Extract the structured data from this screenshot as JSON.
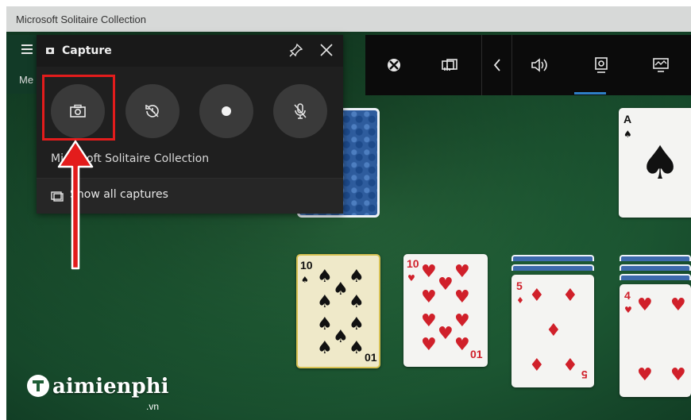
{
  "window": {
    "title": "Microsoft Solitaire Collection"
  },
  "game": {
    "menu_label": "Me"
  },
  "capture_widget": {
    "title": "Capture",
    "app_name": "Microsoft Solitaire Collection",
    "show_all_label": "Show all captures",
    "buttons": [
      "screenshot",
      "record-last",
      "start-recording",
      "microphone-off"
    ]
  },
  "game_bar": {
    "icons": [
      "xbox-icon",
      "widget-menu-icon",
      "chevron-left-icon",
      "audio-icon",
      "capture-icon",
      "performance-icon"
    ]
  },
  "cards": {
    "top_right": {
      "rank": "A",
      "suit": "♠"
    },
    "ten_spades": {
      "rank": "10",
      "bottom_rank": "01"
    },
    "ten_hearts": {
      "rank": "10",
      "bottom_rank": "01"
    },
    "five_diamonds": {
      "rank": "5",
      "bottom_rank": "5"
    },
    "four_hearts": {
      "rank": "4"
    }
  },
  "watermark": {
    "brand": "aimienphi",
    "tld": ".vn"
  },
  "colors": {
    "highlight": "#e31c1c",
    "felt": "#1f5e36",
    "red_suit": "#d0202a"
  }
}
